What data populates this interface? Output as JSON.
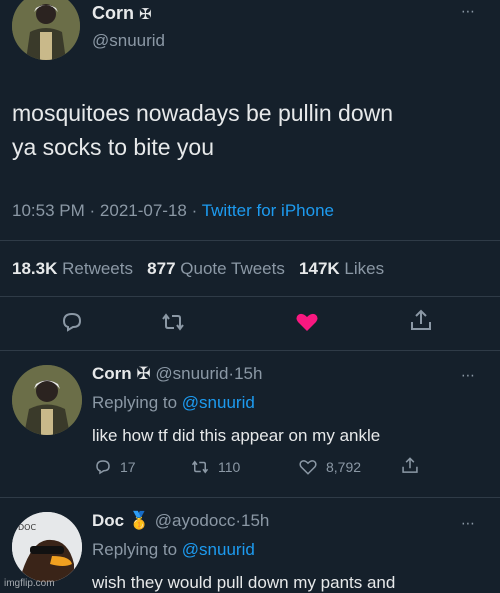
{
  "main_tweet": {
    "display_name": "Corn",
    "badge": "✠",
    "handle": "@snuurid",
    "text_line1": "mosquitoes nowadays be pullin down",
    "text_line2": "ya socks to bite you",
    "time": "10:53 PM",
    "date": "2021-07-18",
    "source": "Twitter for iPhone",
    "retweets_count": "18.3K",
    "retweets_label": "Retweets",
    "quotes_count": "877",
    "quotes_label": "Quote Tweets",
    "likes_count": "147K",
    "likes_label": "Likes",
    "liked_color": "#f91880"
  },
  "reply1": {
    "display_name": "Corn",
    "badge": "✠",
    "handle": "@snuurid",
    "age": "15h",
    "replying_prefix": "Replying to",
    "replying_handle": "@snuurid",
    "text": "like how tf did this appear on my ankle",
    "replies": "17",
    "retweets": "110",
    "likes": "8,792"
  },
  "reply2": {
    "display_name": "Doc",
    "badge": "🥇",
    "handle": "@ayodocc",
    "age": "15h",
    "replying_prefix": "Replying to",
    "replying_handle": "@snuurid",
    "text": "wish they would pull down my pants and"
  },
  "watermark": "imgflip.com",
  "separator": "·",
  "more_icon": "⋯"
}
